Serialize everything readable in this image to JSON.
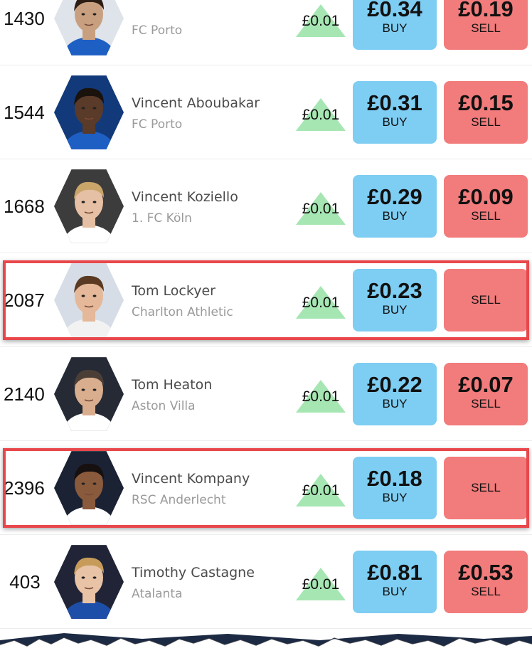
{
  "colors": {
    "buy": "#7ecdf2",
    "sell": "#f27b7b",
    "rise_triangle": "#a6e6b3",
    "highlight_border": "#e8474b"
  },
  "players": [
    {
      "rank": "1430",
      "name": "",
      "club": "FC Porto",
      "change": "£0.01",
      "buy_price": "£0.34",
      "buy_label": "BUY",
      "sell_price": "£0.19",
      "sell_label": "SELL",
      "icon": "player-photo"
    },
    {
      "rank": "1544",
      "name": "Vincent Aboubakar",
      "club": "FC Porto",
      "change": "£0.01",
      "buy_price": "£0.31",
      "buy_label": "BUY",
      "sell_price": "£0.15",
      "sell_label": "SELL",
      "icon": "player-photo"
    },
    {
      "rank": "1668",
      "name": "Vincent Koziello",
      "club": "1. FC Köln",
      "change": "£0.01",
      "buy_price": "£0.29",
      "buy_label": "BUY",
      "sell_price": "£0.09",
      "sell_label": "SELL",
      "icon": "player-photo"
    },
    {
      "rank": "2087",
      "name": "Tom Lockyer",
      "club": "Charlton Athletic",
      "change": "£0.01",
      "buy_price": "£0.23",
      "buy_label": "BUY",
      "sell_price": "",
      "sell_label": "SELL",
      "highlighted": true,
      "icon": "player-photo"
    },
    {
      "rank": "2140",
      "name": "Tom Heaton",
      "club": "Aston Villa",
      "change": "£0.01",
      "buy_price": "£0.22",
      "buy_label": "BUY",
      "sell_price": "£0.07",
      "sell_label": "SELL",
      "icon": "player-photo"
    },
    {
      "rank": "2396",
      "name": "Vincent Kompany",
      "club": "RSC Anderlecht",
      "change": "£0.01",
      "buy_price": "£0.18",
      "buy_label": "BUY",
      "sell_price": "",
      "sell_label": "SELL",
      "highlighted": true,
      "icon": "player-photo"
    },
    {
      "rank": "403",
      "name": "Timothy Castagne",
      "club": "Atalanta",
      "change": "£0.01",
      "buy_price": "£0.81",
      "buy_label": "BUY",
      "sell_price": "£0.53",
      "sell_label": "SELL",
      "icon": "player-photo"
    }
  ]
}
